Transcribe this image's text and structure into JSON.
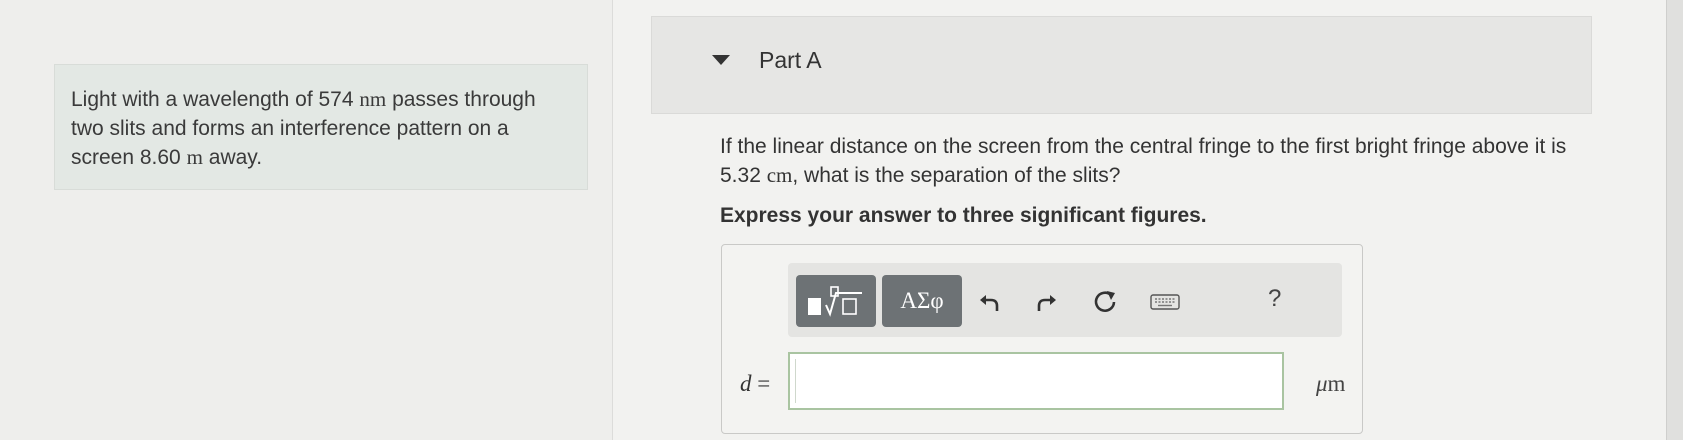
{
  "problem": {
    "line1_pre": "Light with a wavelength of 574",
    "line1_unit": "nm",
    "line1_post": "passes through",
    "line2": "two slits and forms an interference pattern on a",
    "line3_pre": "screen 8.60",
    "line3_unit": "m",
    "line3_post": "away."
  },
  "part": {
    "title": "Part A"
  },
  "question": {
    "line1": "If the linear distance on the screen from the central fringe to the first bright fringe above it is",
    "line2_value": "5.32",
    "line2_unit": "cm",
    "line2_post": ", what is the separation of the slits?"
  },
  "instruction": "Express your answer to three significant figures.",
  "toolbar": {
    "greek_label": "ΑΣφ",
    "help_label": "?"
  },
  "answer": {
    "variable": "d",
    "equals": "=",
    "value": "",
    "unit_mu": "μ",
    "unit_m": "m"
  },
  "colors": {
    "problem_bg": "#e3e8e4",
    "toolbar_button": "#6d7275",
    "input_border": "#a9c4a1"
  }
}
